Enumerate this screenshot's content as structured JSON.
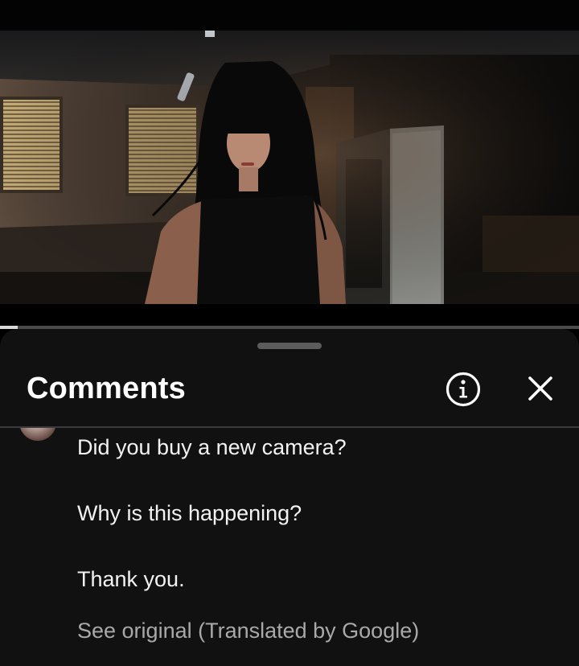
{
  "video": {
    "progress_fraction": 0.03
  },
  "comments_panel": {
    "title": "Comments",
    "info_icon": "info-circle-icon",
    "close_icon": "close-x-icon"
  },
  "comment": {
    "lines": [
      "Did you buy a new camera?",
      "Why is this happening?",
      "Thank you."
    ],
    "see_original": "See original (Translated by Google)"
  },
  "colors": {
    "sheet_background": "#111111",
    "text_primary": "#f2f2f2",
    "text_secondary": "#a9a9a9"
  }
}
